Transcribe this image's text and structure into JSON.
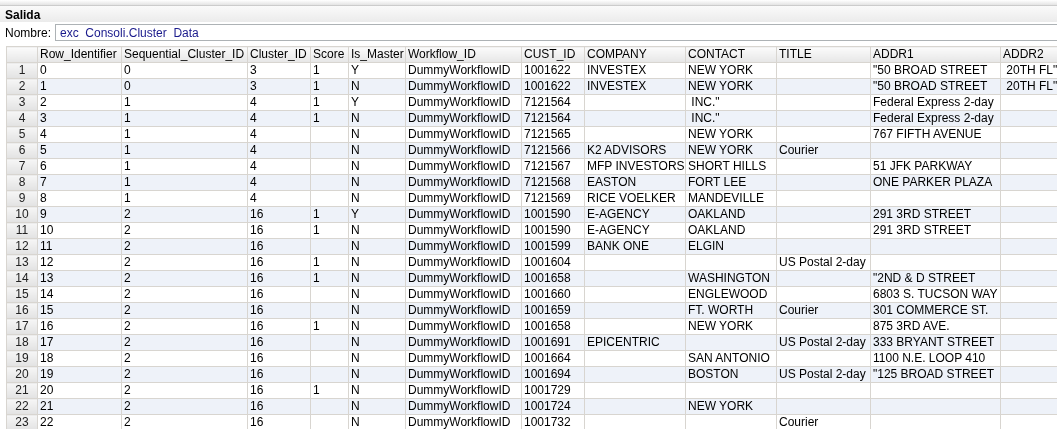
{
  "panel": {
    "title": "Salida",
    "name_label": "Nombre:",
    "name_value": "exc  Consoli.Cluster  Data"
  },
  "table": {
    "columns": [
      "Row_Identifier",
      "Sequential_Cluster_ID",
      "Cluster_ID",
      "Score",
      "Is_Master",
      "Workflow_ID",
      "CUST_ID",
      "COMPANY",
      "CONTACT",
      "TITLE",
      "ADDR1",
      "ADDR2"
    ],
    "rows": [
      {
        "number": "1",
        "cells": [
          "0",
          "0",
          "3",
          "1",
          "Y",
          "DummyWorkflowID",
          "1001622",
          "INVESTEX",
          "NEW YORK",
          null,
          "\"50 BROAD STREET",
          " 20TH FL\""
        ]
      },
      {
        "number": "2",
        "cells": [
          "1",
          "0",
          "3",
          "1",
          "N",
          "DummyWorkflowID",
          "1001622",
          "INVESTEX",
          "NEW YORK",
          null,
          "\"50 BROAD STREET",
          " 20TH FL\""
        ]
      },
      {
        "number": "3",
        "cells": [
          "2",
          "1",
          "4",
          "1",
          "Y",
          "DummyWorkflowID",
          "7121564",
          null,
          " INC.\"",
          null,
          "Federal Express 2-day",
          null
        ]
      },
      {
        "number": "4",
        "cells": [
          "3",
          "1",
          "4",
          "1",
          "N",
          "DummyWorkflowID",
          "7121564",
          null,
          " INC.\"",
          null,
          "Federal Express 2-day",
          null
        ]
      },
      {
        "number": "5",
        "cells": [
          "4",
          "1",
          "4",
          null,
          "N",
          "DummyWorkflowID",
          "7121565",
          null,
          "NEW YORK",
          null,
          "767 FIFTH AVENUE",
          null
        ]
      },
      {
        "number": "6",
        "cells": [
          "5",
          "1",
          "4",
          null,
          "N",
          "DummyWorkflowID",
          "7121566",
          "K2 ADVISORS",
          "NEW YORK",
          "Courier",
          null,
          null
        ]
      },
      {
        "number": "7",
        "cells": [
          "6",
          "1",
          "4",
          null,
          "N",
          "DummyWorkflowID",
          "7121567",
          "MFP INVESTORS",
          "SHORT HILLS",
          null,
          "51 JFK PARKWAY",
          null
        ]
      },
      {
        "number": "8",
        "cells": [
          "7",
          "1",
          "4",
          null,
          "N",
          "DummyWorkflowID",
          "7121568",
          "EASTON",
          "FORT LEE",
          null,
          "ONE PARKER PLAZA",
          null
        ]
      },
      {
        "number": "9",
        "cells": [
          "8",
          "1",
          "4",
          null,
          "N",
          "DummyWorkflowID",
          "7121569",
          "RICE VOELKER",
          "MANDEVILLE",
          null,
          null,
          null
        ]
      },
      {
        "number": "10",
        "cells": [
          "9",
          "2",
          "16",
          "1",
          "Y",
          "DummyWorkflowID",
          "1001590",
          "E-AGENCY",
          "OAKLAND",
          null,
          "291 3RD STREET",
          null
        ]
      },
      {
        "number": "11",
        "cells": [
          "10",
          "2",
          "16",
          "1",
          "N",
          "DummyWorkflowID",
          "1001590",
          "E-AGENCY",
          "OAKLAND",
          null,
          "291 3RD STREET",
          null
        ]
      },
      {
        "number": "12",
        "cells": [
          "11",
          "2",
          "16",
          null,
          "N",
          "DummyWorkflowID",
          "1001599",
          "BANK ONE",
          "ELGIN",
          null,
          null,
          null
        ]
      },
      {
        "number": "13",
        "cells": [
          "12",
          "2",
          "16",
          "1",
          "N",
          "DummyWorkflowID",
          "1001604",
          null,
          null,
          "US Postal 2-day",
          null,
          null
        ]
      },
      {
        "number": "14",
        "cells": [
          "13",
          "2",
          "16",
          "1",
          "N",
          "DummyWorkflowID",
          "1001658",
          null,
          "WASHINGTON",
          null,
          "\"2ND & D STREET",
          null
        ]
      },
      {
        "number": "15",
        "cells": [
          "14",
          "2",
          "16",
          null,
          "N",
          "DummyWorkflowID",
          "1001660",
          null,
          "ENGLEWOOD",
          null,
          "6803 S. TUCSON WAY",
          null
        ]
      },
      {
        "number": "16",
        "cells": [
          "15",
          "2",
          "16",
          null,
          "N",
          "DummyWorkflowID",
          "1001659",
          null,
          "FT. WORTH",
          "Courier",
          "301 COMMERCE ST.",
          null
        ]
      },
      {
        "number": "17",
        "cells": [
          "16",
          "2",
          "16",
          "1",
          "N",
          "DummyWorkflowID",
          "1001658",
          null,
          "NEW YORK",
          null,
          "875 3RD AVE.",
          null
        ]
      },
      {
        "number": "18",
        "cells": [
          "17",
          "2",
          "16",
          null,
          "N",
          "DummyWorkflowID",
          "1001691",
          "EPICENTRIC",
          null,
          "US Postal 2-day",
          "333 BRYANT STREET",
          null
        ]
      },
      {
        "number": "19",
        "cells": [
          "18",
          "2",
          "16",
          null,
          "N",
          "DummyWorkflowID",
          "1001664",
          null,
          "SAN ANTONIO",
          null,
          "1100 N.E. LOOP 410",
          null
        ]
      },
      {
        "number": "20",
        "cells": [
          "19",
          "2",
          "16",
          null,
          "N",
          "DummyWorkflowID",
          "1001694",
          null,
          "BOSTON",
          "US Postal 2-day",
          "\"125 BROAD STREET",
          null
        ]
      },
      {
        "number": "21",
        "cells": [
          "20",
          "2",
          "16",
          "1",
          "N",
          "DummyWorkflowID",
          "1001729",
          null,
          null,
          null,
          null,
          null
        ]
      },
      {
        "number": "22",
        "cells": [
          "21",
          "2",
          "16",
          null,
          "N",
          "DummyWorkflowID",
          "1001724",
          null,
          "NEW YORK",
          null,
          null,
          null
        ]
      },
      {
        "number": "23",
        "cells": [
          "22",
          "2",
          "16",
          null,
          "N",
          "DummyWorkflowID",
          "1001732",
          null,
          null,
          "Courier",
          null,
          null
        ]
      }
    ]
  }
}
